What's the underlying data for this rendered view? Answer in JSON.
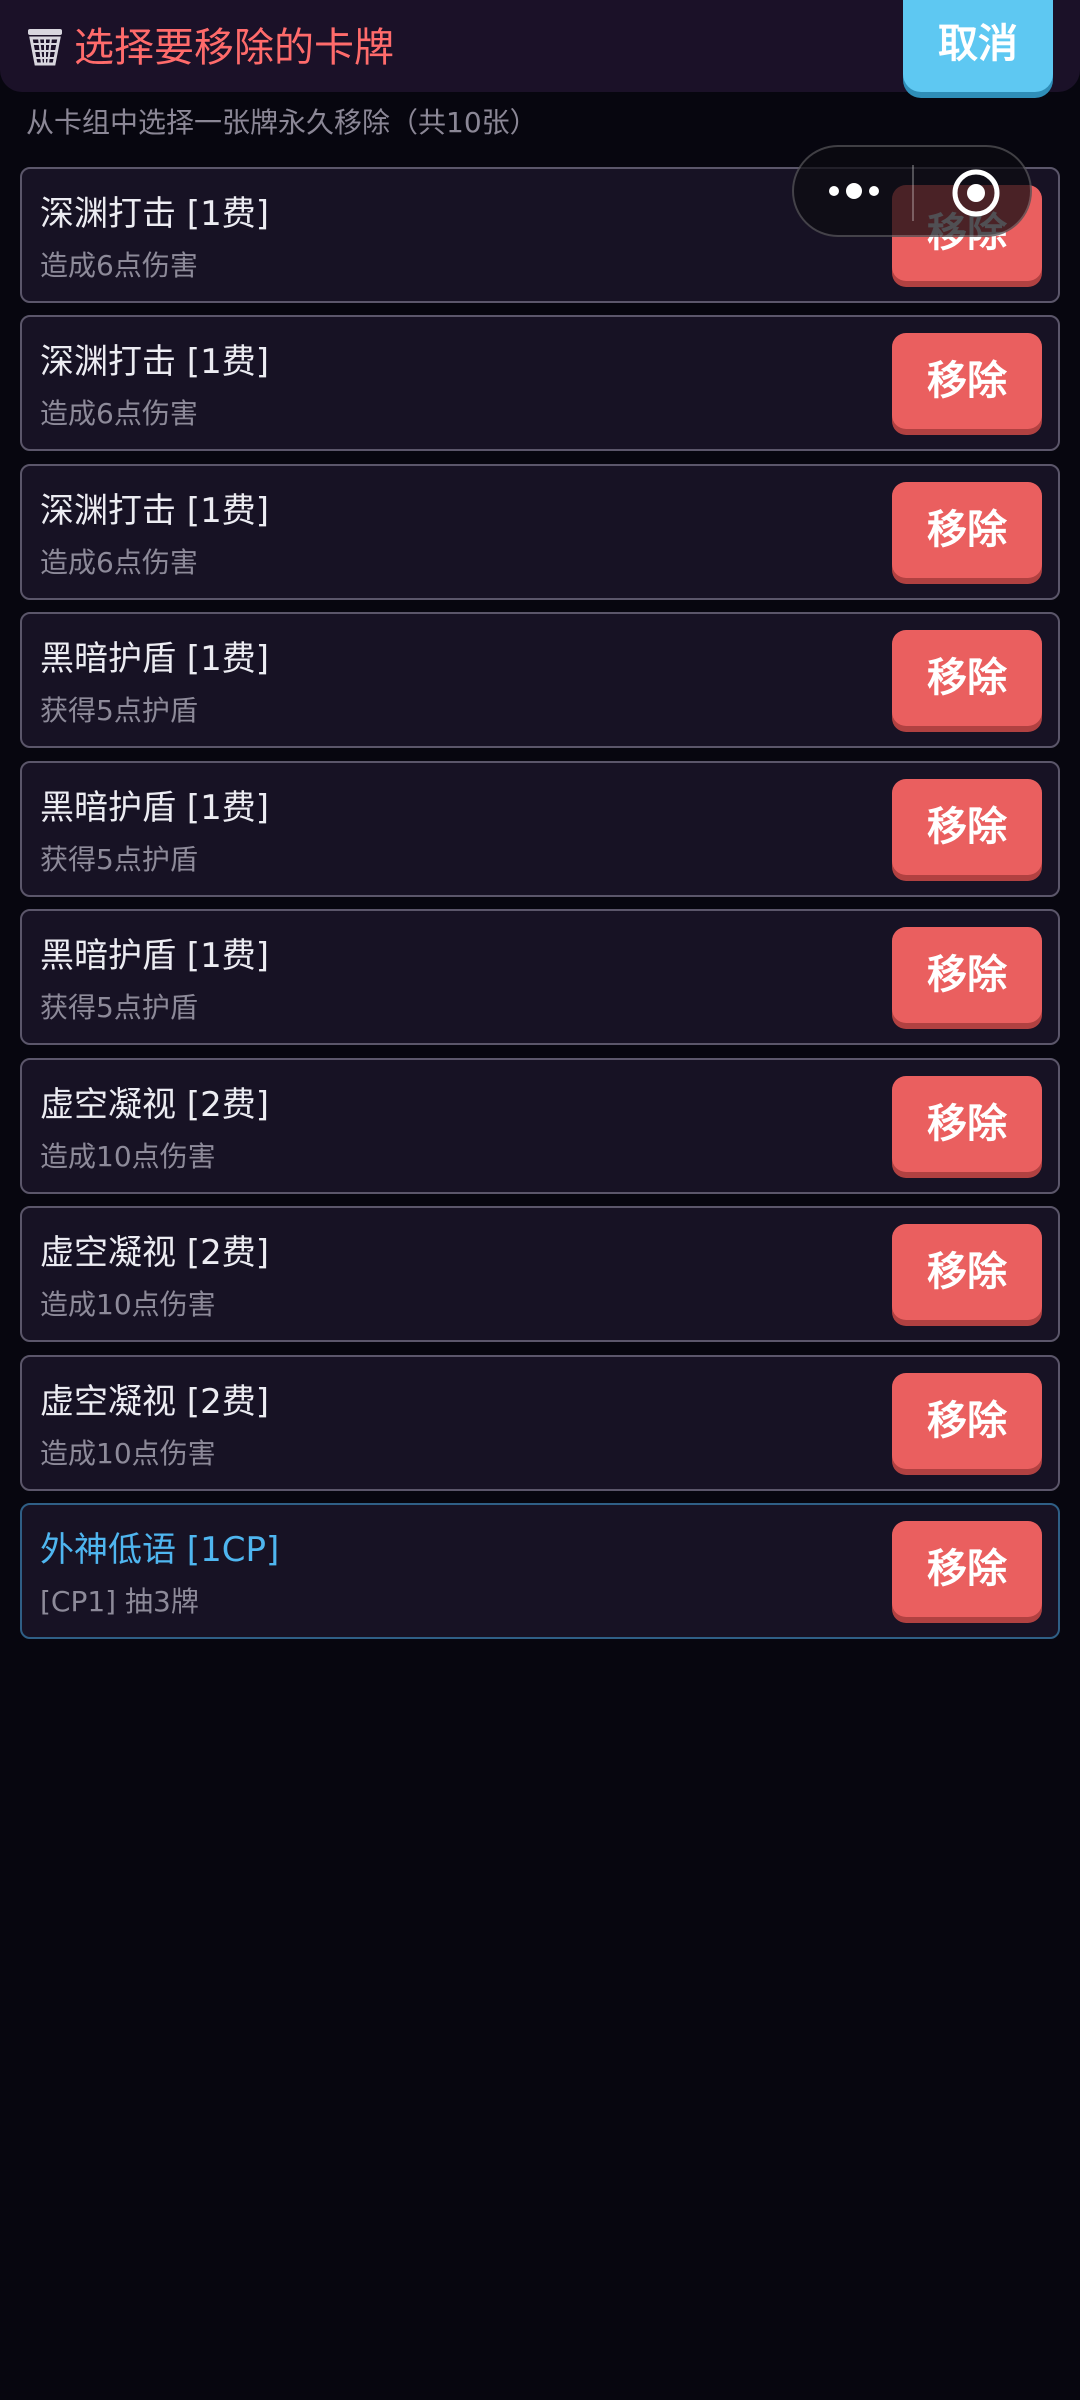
{
  "header": {
    "icon": "basket-icon",
    "title": "选择要移除的卡牌",
    "cancel_label": "取消"
  },
  "subtitle": "从卡组中选择一张牌永久移除（共10张）",
  "capsule": {
    "more_icon": "more-dots-icon",
    "close_icon": "target-circle-icon"
  },
  "cards": [
    {
      "name": "深渊打击 [1费]",
      "desc": "造成6点伤害",
      "button": "移除"
    },
    {
      "name": "深渊打击 [1费]",
      "desc": "造成6点伤害",
      "button": "移除"
    },
    {
      "name": "深渊打击 [1费]",
      "desc": "造成6点伤害",
      "button": "移除"
    },
    {
      "name": "黑暗护盾 [1费]",
      "desc": "获得5点护盾",
      "button": "移除"
    },
    {
      "name": "黑暗护盾 [1费]",
      "desc": "获得5点护盾",
      "button": "移除"
    },
    {
      "name": "黑暗护盾 [1费]",
      "desc": "获得5点护盾",
      "button": "移除"
    },
    {
      "name": "虚空凝视 [2费]",
      "desc": "造成10点伤害",
      "button": "移除"
    },
    {
      "name": "虚空凝视 [2费]",
      "desc": "造成10点伤害",
      "button": "移除"
    },
    {
      "name": "虚空凝视 [2费]",
      "desc": "造成10点伤害",
      "button": "移除"
    },
    {
      "name": "外神低语 [1CP]",
      "desc": "[CP1] 抽3牌",
      "button": "移除"
    }
  ],
  "colors": {
    "title": "#ff6b6b",
    "cancel_button": "#5ec8f2",
    "remove_button": "#ea5f5f",
    "special_card_name": "#4fb6f0"
  }
}
